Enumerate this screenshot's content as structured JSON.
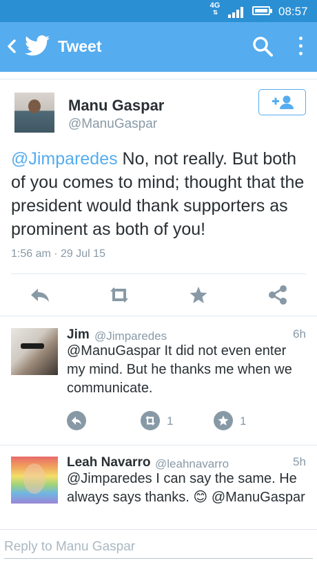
{
  "status_bar": {
    "network": "4G",
    "time": "08:57"
  },
  "header": {
    "title": "Tweet",
    "icons": [
      "back-icon",
      "twitter-bird-icon",
      "search-icon",
      "overflow-menu-icon"
    ]
  },
  "tweet": {
    "author_name": "Manu Gaspar",
    "author_handle": "@ManuGaspar",
    "mention": "@Jimparedes",
    "text": " No, not really. But both of you comes to mind; thought that the president would thank supporters as prominent as both of you!",
    "timestamp": "1:56 am · 29 Jul 15",
    "actions": [
      "reply-icon",
      "retweet-icon",
      "favorite-icon",
      "share-icon"
    ]
  },
  "replies": [
    {
      "name": "Jim",
      "handle": "@Jimparedes",
      "time": "6h",
      "text": "@ManuGaspar It did not even enter my mind. But he thanks me when we communicate.",
      "retweet_count": "1",
      "favorite_count": "1"
    },
    {
      "name": "Leah Navarro",
      "handle": "@leahnavarro",
      "time": "5h",
      "text": "@Jimparedes I can say the same. He always says thanks. 😊 @ManuGaspar"
    }
  ],
  "reply_box": {
    "placeholder": "Reply to Manu Gaspar"
  },
  "colors": {
    "status_bar": "#2b8fd4",
    "action_bar": "#55acee",
    "link": "#55acee",
    "muted": "#8899a6",
    "text": "#292f33"
  }
}
